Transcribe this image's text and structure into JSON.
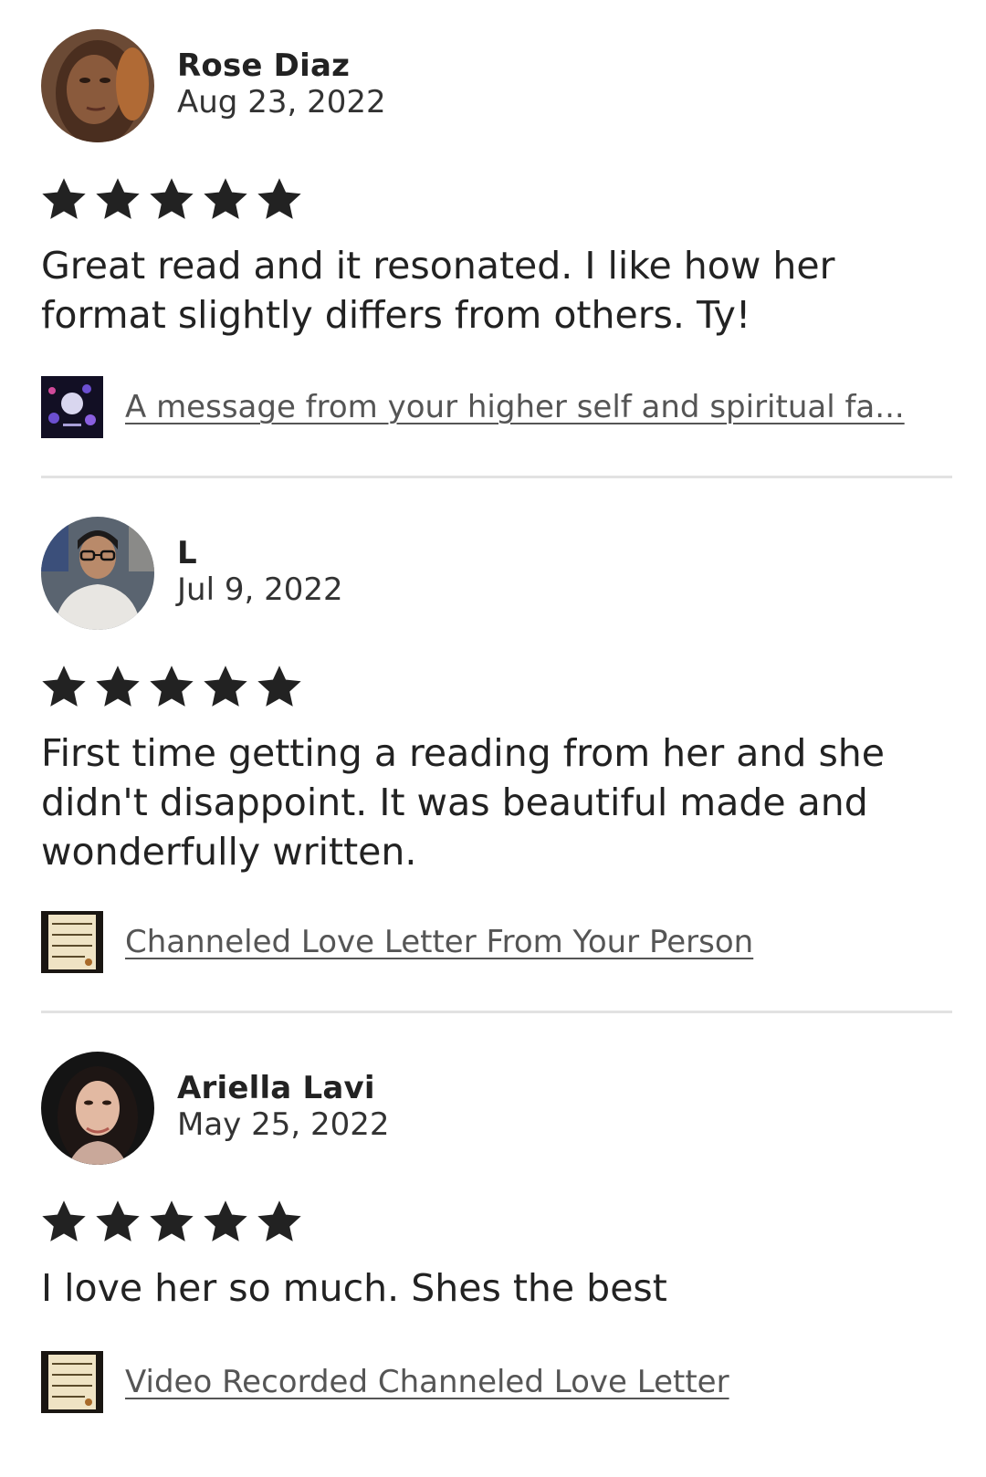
{
  "reviews": [
    {
      "reviewer": "Rose Diaz",
      "date": "Aug 23, 2022",
      "rating": 5,
      "max_rating": 5,
      "text": "Great read and it resonated. I like how her format slightly differs from others. Ty!",
      "listing_title": "A message from your higher self and spiritual fa..."
    },
    {
      "reviewer": "L",
      "date": "Jul 9, 2022",
      "rating": 5,
      "max_rating": 5,
      "text": "First time getting a reading from her and she didn't disappoint. It was beautiful made and wonderfully written.",
      "listing_title": "Channeled Love Letter From Your Person"
    },
    {
      "reviewer": "Ariella Lavi",
      "date": "May 25, 2022",
      "rating": 5,
      "max_rating": 5,
      "text": "I love her so much. Shes the best",
      "listing_title": "Video Recorded Channeled Love Letter"
    }
  ],
  "colors": {
    "star": "#222222",
    "link": "#555555",
    "divider": "#e2e2e2"
  }
}
